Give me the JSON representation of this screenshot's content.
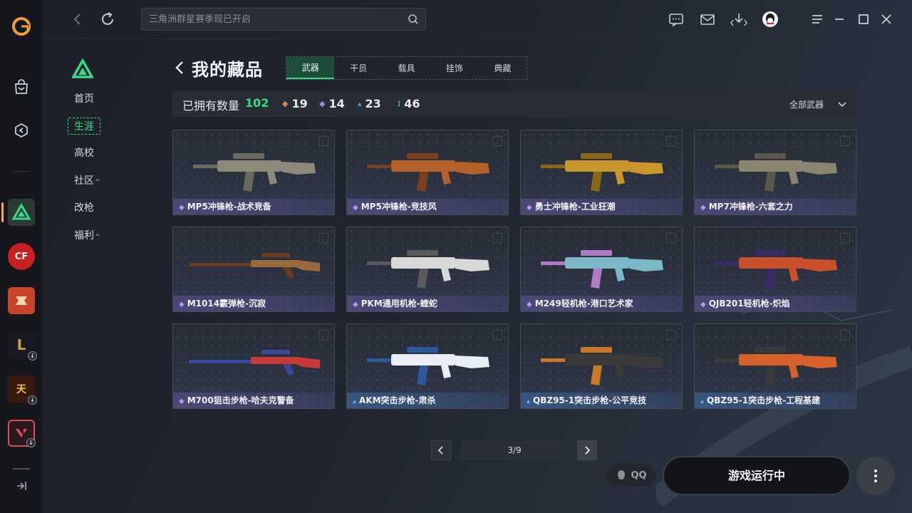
{
  "search": {
    "placeholder": "三角洲群星赛季现已开启"
  },
  "subnav": {
    "items": [
      {
        "label": "首页",
        "caret": ""
      },
      {
        "label": "生涯",
        "caret": ""
      },
      {
        "label": "高校",
        "caret": ""
      },
      {
        "label": "社区",
        "caret": "^"
      },
      {
        "label": "改枪",
        "caret": ""
      },
      {
        "label": "福利",
        "caret": "^"
      }
    ]
  },
  "header": {
    "title": "我的藏品",
    "tabs": [
      {
        "label": "武器",
        "active": true
      },
      {
        "label": "干员",
        "active": false
      },
      {
        "label": "载具",
        "active": false
      },
      {
        "label": "挂饰",
        "active": false
      },
      {
        "label": "典藏",
        "active": false
      }
    ]
  },
  "stats": {
    "label": "已拥有数量",
    "total": "102",
    "counts": [
      {
        "icon": "orange-diamond-icon",
        "color": "#e0843a",
        "value": "19"
      },
      {
        "icon": "purple-diamond-icon",
        "color": "#a77ee8",
        "value": "14"
      },
      {
        "icon": "blue-triangle-icon",
        "color": "#4c9ee8",
        "value": "23"
      },
      {
        "icon": "green-dots-icon",
        "color": "#3ad98a",
        "value": "46"
      }
    ],
    "filter": "全部武器"
  },
  "weapons": [
    {
      "name": "MP5冲锋枪-战术竞备",
      "rarity": "purple",
      "color": "#8e8a7a",
      "accent": "#6b6a60"
    },
    {
      "name": "MP5冲锋枪-竞技风",
      "rarity": "purple",
      "color": "#b5622a",
      "accent": "#7a4020"
    },
    {
      "name": "勇士冲锋枪-工业狂潮",
      "rarity": "purple",
      "color": "#c8962a",
      "accent": "#8a6618"
    },
    {
      "name": "MP7冲锋枪-六套之力",
      "rarity": "purple",
      "color": "#8a8570",
      "accent": "#5a584a"
    },
    {
      "name": "M1014霰弹枪-沉寂",
      "rarity": "purple",
      "color": "#9a6a3a",
      "accent": "#6a3a22"
    },
    {
      "name": "PKM通用机枪-蝰蛇",
      "rarity": "purple",
      "color": "#d8d8d8",
      "accent": "#5a5a5a"
    },
    {
      "name": "M249轻机枪-港口艺术家",
      "rarity": "purple",
      "color": "#7ab8c8",
      "accent": "#b07ac8"
    },
    {
      "name": "QJB201轻机枪-炽焰",
      "rarity": "purple",
      "color": "#c8502a",
      "accent": "#3a2a6a"
    },
    {
      "name": "M700狙击步枪-哈夫克警备",
      "rarity": "purple",
      "color": "#c83a3a",
      "accent": "#3a4a9a"
    },
    {
      "name": "AKM突击步枪-肃杀",
      "rarity": "blue",
      "color": "#e8eef4",
      "accent": "#2a5a9a"
    },
    {
      "name": "QBZ95-1突击步枪-公平竞技",
      "rarity": "blue",
      "color": "#3a3a3a",
      "accent": "#c87a2a"
    },
    {
      "name": "QBZ95-1突击步枪-工程基建",
      "rarity": "blue",
      "color": "#d8602a",
      "accent": "#3a3a3a"
    }
  ],
  "pagination": {
    "current": "3/9"
  },
  "bottom": {
    "qq_label": "QQ",
    "launch_label": "游戏运行中"
  }
}
